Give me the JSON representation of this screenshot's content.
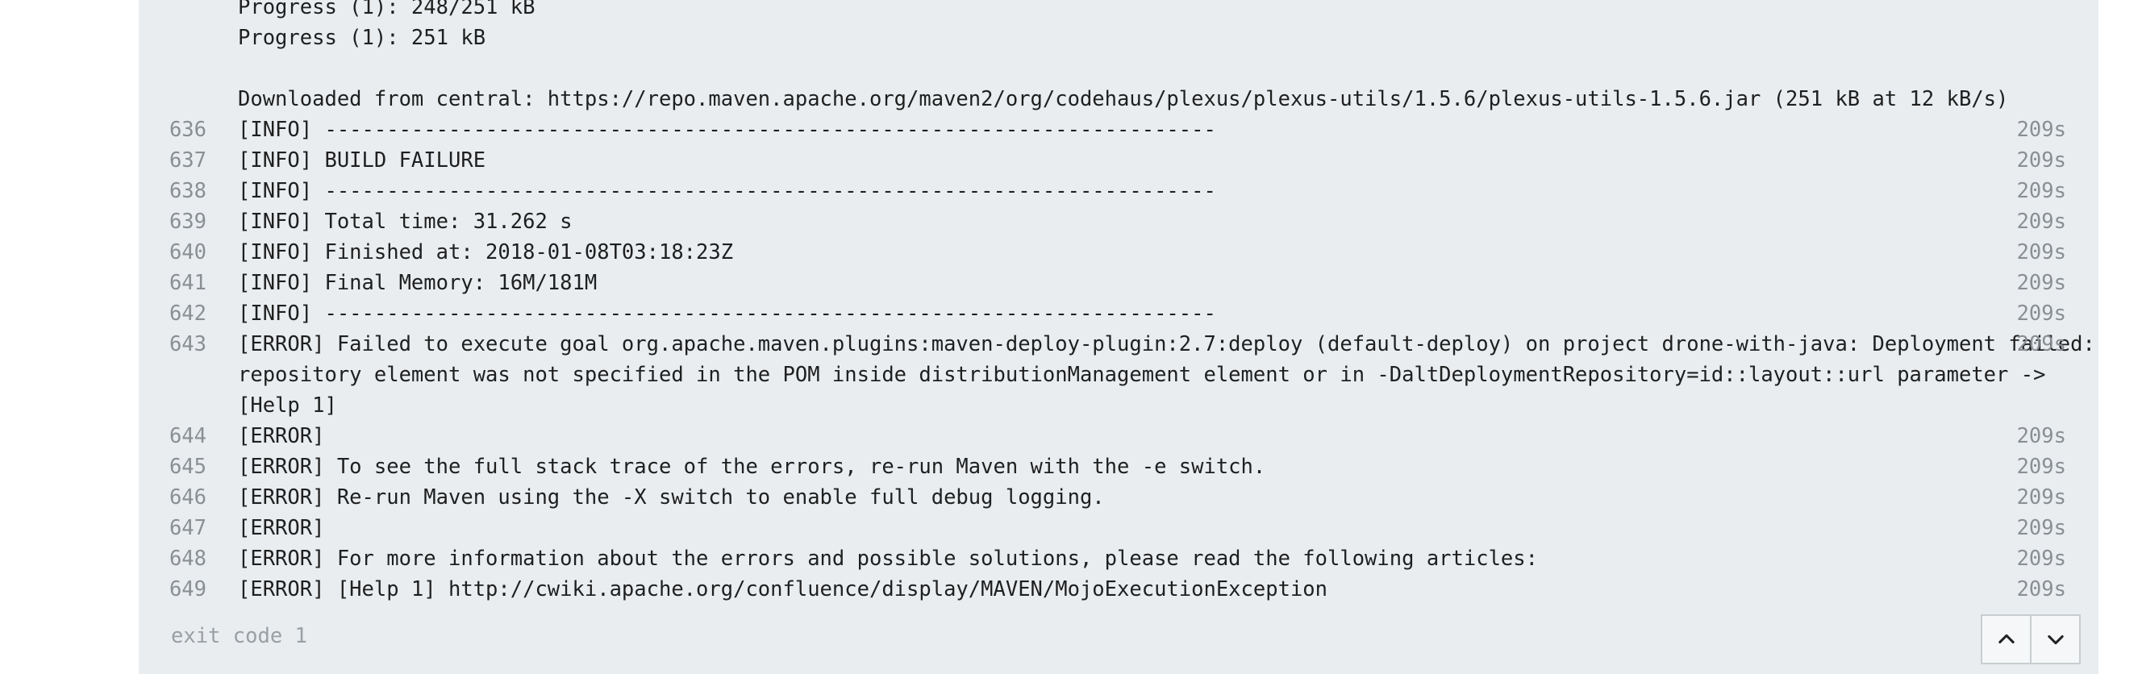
{
  "log": {
    "lines": [
      {
        "num": "",
        "text": "Progress (1): 248/251 kB",
        "time": ""
      },
      {
        "num": "",
        "text": "Progress (1): 251 kB",
        "time": ""
      },
      {
        "num": "",
        "text": "",
        "time": ""
      },
      {
        "num": "",
        "text": "Downloaded from central: https://repo.maven.apache.org/maven2/org/codehaus/plexus/plexus-utils/1.5.6/plexus-utils-1.5.6.jar (251 kB at 12 kB/s)",
        "time": ""
      },
      {
        "num": "636",
        "text": "[INFO] ------------------------------------------------------------------------",
        "time": "209s"
      },
      {
        "num": "637",
        "text": "[INFO] BUILD FAILURE",
        "time": "209s"
      },
      {
        "num": "638",
        "text": "[INFO] ------------------------------------------------------------------------",
        "time": "209s"
      },
      {
        "num": "639",
        "text": "[INFO] Total time: 31.262 s",
        "time": "209s"
      },
      {
        "num": "640",
        "text": "[INFO] Finished at: 2018-01-08T03:18:23Z",
        "time": "209s"
      },
      {
        "num": "641",
        "text": "[INFO] Final Memory: 16M/181M",
        "time": "209s"
      },
      {
        "num": "642",
        "text": "[INFO] ------------------------------------------------------------------------",
        "time": "209s"
      },
      {
        "num": "643",
        "text": "[ERROR] Failed to execute goal org.apache.maven.plugins:maven-deploy-plugin:2.7:deploy (default-deploy) on project drone-with-java: Deployment failed:",
        "time": "209s"
      },
      {
        "num": "",
        "text": "repository element was not specified in the POM inside distributionManagement element or in -DaltDeploymentRepository=id::layout::url parameter ->",
        "time": ""
      },
      {
        "num": "",
        "text": "[Help 1]",
        "time": ""
      },
      {
        "num": "644",
        "text": "[ERROR]",
        "time": "209s"
      },
      {
        "num": "645",
        "text": "[ERROR] To see the full stack trace of the errors, re-run Maven with the -e switch.",
        "time": "209s"
      },
      {
        "num": "646",
        "text": "[ERROR] Re-run Maven using the -X switch to enable full debug logging.",
        "time": "209s"
      },
      {
        "num": "647",
        "text": "[ERROR]",
        "time": "209s"
      },
      {
        "num": "648",
        "text": "[ERROR] For more information about the errors and possible solutions, please read the following articles:",
        "time": "209s"
      },
      {
        "num": "649",
        "text": "[ERROR] [Help 1] http://cwiki.apache.org/confluence/display/MAVEN/MojoExecutionException",
        "time": "209s"
      }
    ],
    "exit_code": "exit code 1"
  },
  "controls": {
    "scroll_up_icon": "chevron-up-icon",
    "scroll_down_icon": "chevron-down-icon"
  },
  "colors": {
    "panel_bg": "#e9edf0",
    "text": "#1f1f1f",
    "muted": "#8a8f94"
  }
}
